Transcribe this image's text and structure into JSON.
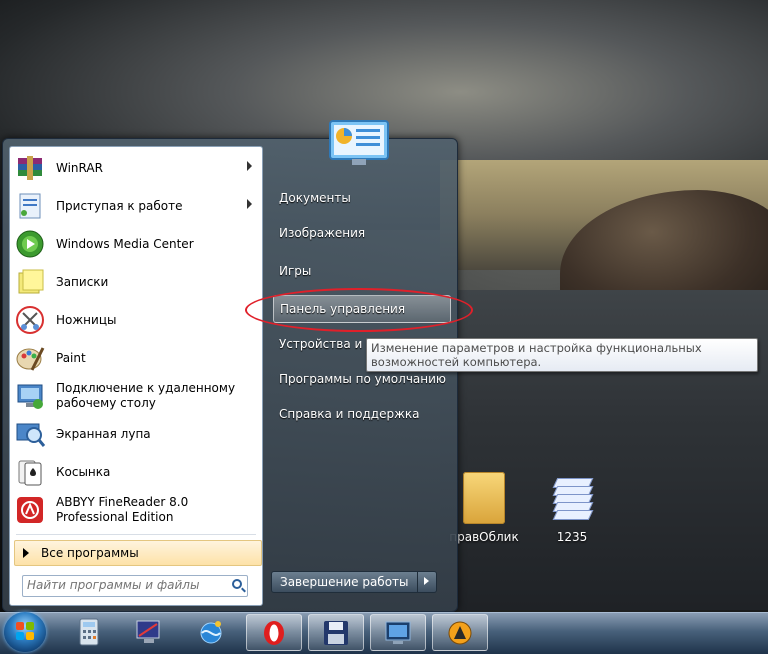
{
  "desktop": {
    "icons": [
      {
        "label": "правОблик",
        "icon": "folder-icon"
      },
      {
        "label": "1235",
        "icon": "stacked-documents-icon"
      }
    ]
  },
  "start_menu": {
    "programs": [
      {
        "label": "WinRAR",
        "icon": "winrar-icon",
        "has_submenu": true
      },
      {
        "label": "Приступая к работе",
        "icon": "getting-started-icon",
        "has_submenu": true
      },
      {
        "label": "Windows Media Center",
        "icon": "media-center-icon",
        "has_submenu": false
      },
      {
        "label": "Записки",
        "icon": "sticky-notes-icon",
        "has_submenu": false
      },
      {
        "label": "Ножницы",
        "icon": "snipping-tool-icon",
        "has_submenu": false
      },
      {
        "label": "Paint",
        "icon": "paint-icon",
        "has_submenu": false
      },
      {
        "label": "Подключение к удаленному рабочему столу",
        "line1": "Подключение к удаленному",
        "line2": "рабочему столу",
        "icon": "remote-desktop-icon",
        "has_submenu": false
      },
      {
        "label": "Экранная лупа",
        "icon": "magnifier-icon",
        "has_submenu": false
      },
      {
        "label": "Косынка",
        "icon": "solitaire-icon",
        "has_submenu": false
      },
      {
        "label": "ABBYY FineReader 8.0 Professional Edition",
        "line1": "ABBYY FineReader 8.0",
        "line2": "Professional Edition",
        "icon": "finereader-icon",
        "has_submenu": false
      }
    ],
    "all_programs_label": "Все программы",
    "search": {
      "placeholder": "Найти программы и файлы",
      "value": ""
    },
    "right_items": [
      {
        "label": "Документы"
      },
      {
        "label": "Изображения"
      },
      {
        "label": "Игры"
      },
      {
        "label": "Панель управления",
        "highlighted": true
      },
      {
        "label": "Устройства и пр"
      },
      {
        "label": "Программы по умолчанию"
      },
      {
        "label": "Справка и поддержка"
      }
    ],
    "shutdown_label": "Завершение работы",
    "tooltip": "Изменение параметров и настройка функциональных возможностей компьютера."
  },
  "taskbar": {
    "buttons": [
      {
        "name": "calculator",
        "icon": "calculator-icon",
        "state": "pinned"
      },
      {
        "name": "monitor-app",
        "icon": "monitor-app-icon",
        "state": "pinned"
      },
      {
        "name": "globe-app",
        "icon": "globe-app-icon",
        "state": "pinned"
      },
      {
        "name": "opera",
        "icon": "opera-icon",
        "state": "open"
      },
      {
        "name": "save-app",
        "icon": "floppy-icon",
        "state": "open"
      },
      {
        "name": "kmplayer",
        "icon": "kmplayer-icon",
        "state": "open"
      },
      {
        "name": "aimp",
        "icon": "aimp-icon",
        "state": "open"
      }
    ]
  },
  "colors": {
    "highlight_ellipse": "#e0202a",
    "all_programs_bg": "#fde2a8"
  }
}
